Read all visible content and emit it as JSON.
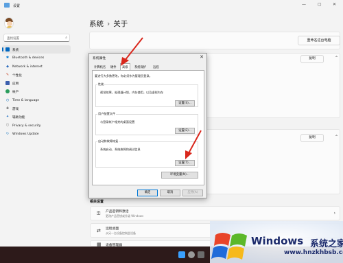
{
  "window": {
    "title": "设置",
    "controls": [
      "—",
      "▢",
      "✕"
    ]
  },
  "sidebar": {
    "search_placeholder": "查找设置",
    "items": [
      {
        "label": "系统",
        "icon": "monitor-icon",
        "color": "#0067c0",
        "active": true
      },
      {
        "label": "Bluetooth & devices",
        "icon": "bluetooth-icon",
        "color": "#0078d4"
      },
      {
        "label": "Network & internet",
        "icon": "network-icon",
        "color": "#2a6bbd"
      },
      {
        "label": "个性化",
        "icon": "brush-icon",
        "color": "#c84a2c"
      },
      {
        "label": "应用",
        "icon": "apps-icon",
        "color": "#3b5fae"
      },
      {
        "label": "帐户",
        "icon": "account-icon",
        "color": "#2a9d5c"
      },
      {
        "label": "Time & language",
        "icon": "clock-globe-icon",
        "color": "#1f7bc1"
      },
      {
        "label": "游戏",
        "icon": "gamepad-icon",
        "color": "#555555"
      },
      {
        "label": "辅助功能",
        "icon": "accessibility-icon",
        "color": "#1f6fc4"
      },
      {
        "label": "Privacy & security",
        "icon": "shield-icon",
        "color": "#6a6a6a"
      },
      {
        "label": "Windows Update",
        "icon": "update-icon",
        "color": "#1f7bc1"
      }
    ]
  },
  "breadcrumb": {
    "parent": "系统",
    "separator": "›",
    "current": "关于"
  },
  "main": {
    "rename_button": "重命名这台电脑",
    "copy_button": "复制",
    "related_settings_title": "相关设置",
    "related": [
      {
        "title": "产品密钥和激活",
        "subtitle": "更改产品密钥或升级 Windows",
        "icon": "key-icon"
      },
      {
        "title": "远程桌面",
        "subtitle": "从另一台设备控制此设备",
        "icon": "remote-icon"
      },
      {
        "title": "设备管理器",
        "subtitle": "",
        "icon": "device-manager-icon"
      }
    ]
  },
  "dialog": {
    "title": "系统属性",
    "close": "✕",
    "tabs": [
      "计算机名",
      "硬件",
      "高级",
      "系统保护",
      "远程"
    ],
    "active_tab": "高级",
    "notice": "要进行大多数更改，你必须作为管理员登录。",
    "groups": [
      {
        "label": "性能",
        "desc": "视觉效果，处理器计划，内存使用，以及虚拟内存",
        "button": "设置(S)..."
      },
      {
        "label": "用户配置文件",
        "desc": "与登录帐户相关的桌面设置",
        "button": "设置(E)..."
      },
      {
        "label": "启动和故障恢复",
        "desc": "系统启动、系统故障和调试信息",
        "button": "设置(T)..."
      }
    ],
    "env_button": "环境变量(N)...",
    "ok": "确定",
    "cancel": "取消",
    "apply": "应用(A)"
  },
  "taskbar": {
    "icons": [
      "windows-start-icon",
      "search-icon",
      "taskview-icon",
      "explorer-icon",
      "edge-icon",
      "store-icon",
      "settings-icon"
    ]
  },
  "watermark": {
    "brand": "Windows",
    "cn": "系统之家",
    "url": "www.hnzkhbsb.com"
  },
  "colors": {
    "accent": "#0067c0",
    "arrow": "#d9271c"
  }
}
